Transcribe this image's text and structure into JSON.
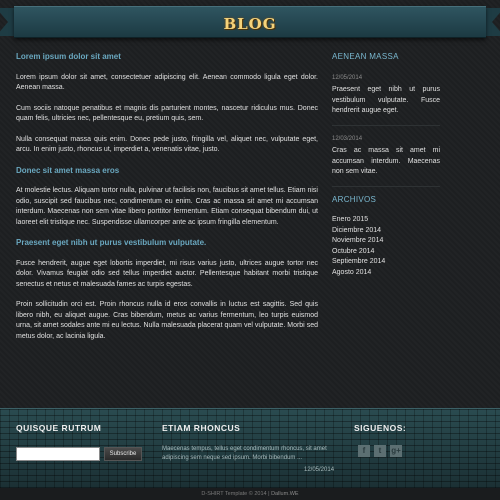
{
  "header": {
    "logo_text": "BLOG"
  },
  "main": {
    "posts": [
      {
        "title": "Lorem ipsum dolor sit amet",
        "paragraphs": [
          "Lorem ipsum dolor sit amet, consectetuer adipiscing elit. Aenean commodo ligula eget dolor. Aenean massa.",
          "Cum sociis natoque penatibus et magnis dis parturient montes, nascetur ridiculus mus. Donec quam felis, ultricies nec, pellentesque eu, pretium quis, sem.",
          "Nulla consequat massa quis enim. Donec pede justo, fringilla vel, aliquet nec, vulputate eget, arcu. In enim justo, rhoncus ut, imperdiet a, venenatis vitae, justo."
        ]
      },
      {
        "title": "Donec sit amet massa eros",
        "paragraphs": [
          "At molestie lectus. Aliquam tortor nulla, pulvinar ut facilisis non, faucibus sit amet tellus. Etiam nisi odio, suscipit sed faucibus nec, condimentum eu enim. Cras ac massa sit amet mi accumsan interdum. Maecenas non sem vitae libero porttitor fermentum. Etiam consequat bibendum dui, ut laoreet elit tristique nec. Suspendisse ullamcorper ante ac ipsum fringilla elementum."
        ]
      },
      {
        "title": "Praesent eget nibh ut purus vestibulum vulputate.",
        "paragraphs": [
          "Fusce hendrerit, augue eget lobortis imperdiet, mi risus varius justo, ultrices augue tortor nec dolor. Vivamus feugiat odio sed tellus imperdiet auctor. Pellentesque habitant morbi tristique senectus et netus et malesuada fames ac turpis egestas.",
          "Proin sollicitudin orci est. Proin rhoncus nulla id eros convallis in luctus est sagittis. Sed quis libero nibh, eu aliquet augue. Cras bibendum, metus ac varius fermentum, leo turpis euismod urna, sit amet sodales ante mi eu lectus. Nulla malesuada placerat quam vel vulputate. Morbi sed metus dolor, ac lacinia ligula."
        ]
      }
    ]
  },
  "sidebar": {
    "news_title": "AENEAN MASSA",
    "news": [
      {
        "date": "12/05/2014",
        "text": "Praesent eget nibh ut purus vestibulum vulputate. Fusce hendrerit augue eget."
      },
      {
        "date": "12/03/2014",
        "text": "Cras ac massa sit amet mi accumsan interdum. Maecenas non sem vitae."
      }
    ],
    "archive_title": "ARCHIVOS",
    "archives": [
      "Enero 2015",
      "Diciembre 2014",
      "Noviembre 2014",
      "Octubre 2014",
      "Septiembre 2014",
      "Agosto 2014"
    ]
  },
  "footer": {
    "newsletter_title": "QUISQUE RUTRUM",
    "newsletter_input_value": "",
    "newsletter_button": "Subscribe",
    "news_title": "ETIAM RHONCUS",
    "news_text": "Maecenas tempus, tellus eget condimentum rhoncus, sit amet adipiscing sem neque sed ipsum. Morbi bibendum ...",
    "news_date": "12/05/2014",
    "social_title": "SIGUENOS:",
    "social": [
      {
        "icon": "facebook-icon",
        "glyph": "f"
      },
      {
        "icon": "twitter-icon",
        "glyph": "t"
      },
      {
        "icon": "googleplus-icon",
        "glyph": "g+"
      }
    ]
  },
  "copyright": {
    "text": "D-SHIRT Template © 2014 | ",
    "link": "Dallum.WE"
  },
  "colors": {
    "accent": "#6aa8c0",
    "logo": "#f5d37a",
    "footer": "#223c40"
  }
}
